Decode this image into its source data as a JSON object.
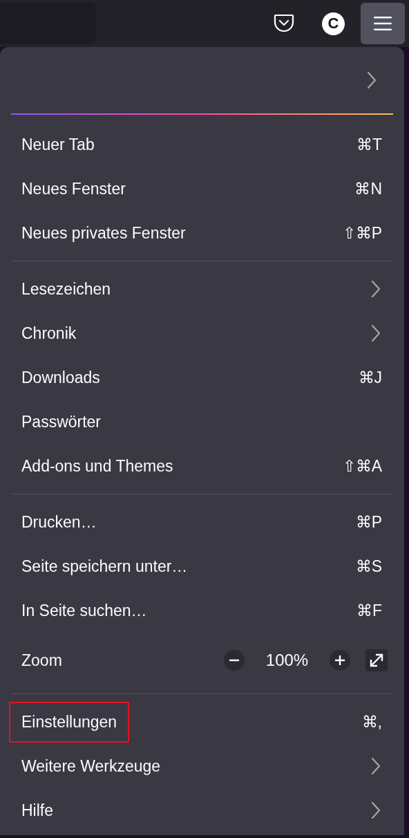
{
  "toolbar": {
    "avatar": "C",
    "menu_button": {
      "selected": true
    }
  },
  "menu": {
    "sections": [
      [
        {
          "kind": "shortcut",
          "label": "Neuer Tab",
          "shortcut": "⌘T",
          "highlighted": false
        },
        {
          "kind": "shortcut",
          "label": "Neues Fenster",
          "shortcut": "⌘N",
          "highlighted": false
        },
        {
          "kind": "shortcut",
          "label": "Neues privates Fenster",
          "shortcut": "⇧⌘P",
          "highlighted": false
        }
      ],
      [
        {
          "kind": "submenu",
          "label": "Lesezeichen",
          "highlighted": false
        },
        {
          "kind": "submenu",
          "label": "Chronik",
          "highlighted": false
        },
        {
          "kind": "shortcut",
          "label": "Downloads",
          "shortcut": "⌘J",
          "highlighted": false
        },
        {
          "kind": "plain",
          "label": "Passwörter",
          "highlighted": false
        },
        {
          "kind": "shortcut",
          "label": "Add-ons und Themes",
          "shortcut": "⇧⌘A",
          "highlighted": false
        }
      ],
      [
        {
          "kind": "shortcut",
          "label": "Drucken…",
          "shortcut": "⌘P",
          "highlighted": false
        },
        {
          "kind": "shortcut",
          "label": "Seite speichern unter…",
          "shortcut": "⌘S",
          "highlighted": false
        },
        {
          "kind": "shortcut",
          "label": "In Seite suchen…",
          "shortcut": "⌘F",
          "highlighted": false
        },
        {
          "kind": "zoom",
          "label": "Zoom",
          "zoom_level": "100%",
          "highlighted": false
        }
      ],
      [
        {
          "kind": "shortcut",
          "label": "Einstellungen",
          "shortcut": "⌘,",
          "highlighted": true
        },
        {
          "kind": "submenu",
          "label": "Weitere Werkzeuge",
          "highlighted": false
        },
        {
          "kind": "submenu",
          "label": "Hilfe",
          "highlighted": false
        }
      ]
    ]
  }
}
